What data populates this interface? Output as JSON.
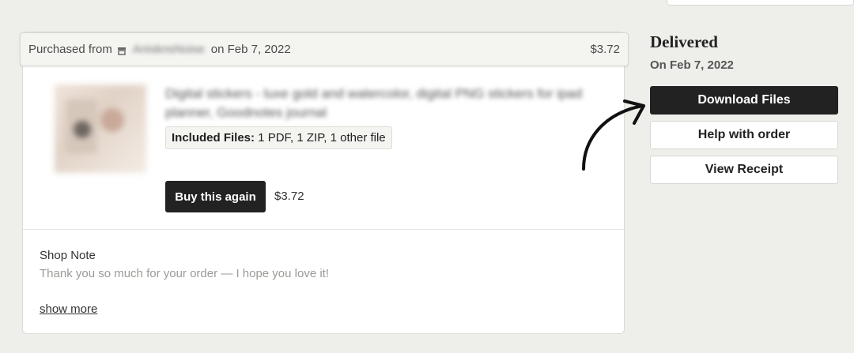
{
  "order": {
    "purchased_prefix": "Purchased from",
    "shop_name": "AnisknsNoise",
    "purchased_on": "on Feb 7, 2022",
    "total": "$3.72"
  },
  "item": {
    "title": "Digital stickers - luxe gold and watercolor, digital PNG stickers for ipad planner, Goodnotes journal",
    "included_label": "Included Files:",
    "included_value": " 1 PDF, 1 ZIP, 1 other file",
    "buy_again_label": "Buy this again",
    "price": "$3.72"
  },
  "note": {
    "title": "Shop Note",
    "text": "Thank you so much for your order — I hope you love it!",
    "show_more": "show more"
  },
  "status": {
    "title": "Delivered",
    "date": "On Feb 7, 2022"
  },
  "actions": {
    "download": "Download Files",
    "help": "Help with order",
    "receipt": "View Receipt"
  },
  "icons": {
    "shop": "shop-icon",
    "arrow": "hand-drawn-arrow"
  },
  "colors": {
    "background": "#eeeeea",
    "dark_button": "#222222",
    "muted_text": "#9a9a96"
  }
}
